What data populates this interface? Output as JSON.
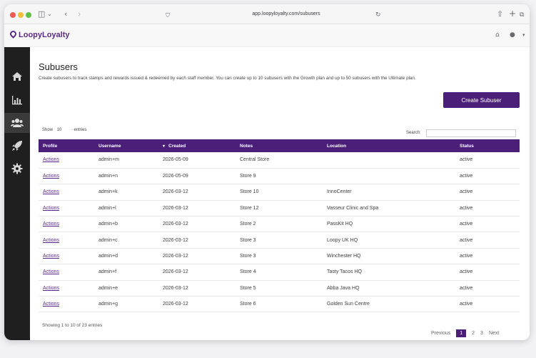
{
  "browser": {
    "url": "app.loopyloyalty.com/subusers"
  },
  "app": {
    "logo_text": "LoopyLoyalty"
  },
  "sidebar": {
    "items": [
      {
        "icon": "home-icon"
      },
      {
        "icon": "bar-chart-icon"
      },
      {
        "icon": "users-icon",
        "active": true
      },
      {
        "icon": "rocket-icon"
      },
      {
        "icon": "gear-icon"
      }
    ]
  },
  "page": {
    "title": "Subusers",
    "description": "Create subusers to track stamps and rewards issued & redeemed by each staff member. You can create up to 10 subusers with the Growth plan and up to 50 subusers with the Ultimate plan.",
    "create_button": "Create Subuser"
  },
  "controls": {
    "show_label": "Show",
    "show_value": "10",
    "entries_label": "entries",
    "search_label": "Search:"
  },
  "table": {
    "headers": [
      "Profile",
      "Username",
      "Created",
      "Notes",
      "Location",
      "Status"
    ],
    "sort_indicator": "▾",
    "rows": [
      {
        "profile": "Actions",
        "username": "admin+m",
        "created": "2026-05-09",
        "notes": "Central Store",
        "location": "",
        "status": "active"
      },
      {
        "profile": "Actions",
        "username": "admin+n",
        "created": "2026-05-09",
        "notes": "Store 9",
        "location": "",
        "status": "active"
      },
      {
        "profile": "Actions",
        "username": "admin+k",
        "created": "2026-03-12",
        "notes": "Store 10",
        "location": "InnoCenter",
        "status": "active"
      },
      {
        "profile": "Actions",
        "username": "admin+l",
        "created": "2026-03-12",
        "notes": "Store 12",
        "location": "Vasseur Clinic and Spa",
        "status": "active"
      },
      {
        "profile": "Actions",
        "username": "admin+b",
        "created": "2026-03-12",
        "notes": "Store 2",
        "location": "PassKit HQ",
        "status": "active"
      },
      {
        "profile": "Actions",
        "username": "admin+c",
        "created": "2026-03-12",
        "notes": "Store 3",
        "location": "Loopy UK HQ",
        "status": "active"
      },
      {
        "profile": "Actions",
        "username": "admin+d",
        "created": "2026-03-12",
        "notes": "Store 3",
        "location": "Winchester HQ",
        "status": "active"
      },
      {
        "profile": "Actions",
        "username": "admin+f",
        "created": "2026-03-12",
        "notes": "Store 4",
        "location": "Tasty Tacos HQ",
        "status": "active"
      },
      {
        "profile": "Actions",
        "username": "admin+e",
        "created": "2026-03-12",
        "notes": "Store 5",
        "location": "Abba Java HQ",
        "status": "active"
      },
      {
        "profile": "Actions",
        "username": "admin+g",
        "created": "2026-03-12",
        "notes": "Store 6",
        "location": "Golden Sun Centre",
        "status": "active"
      }
    ]
  },
  "footer": {
    "info": "Showing 1 to 10 of 23 entries",
    "previous": "Previous",
    "pages": [
      "1",
      "2",
      "3"
    ],
    "next": "Next"
  },
  "colors": {
    "brand": "#4b1f78",
    "sidebar": "#1f1f1f"
  }
}
